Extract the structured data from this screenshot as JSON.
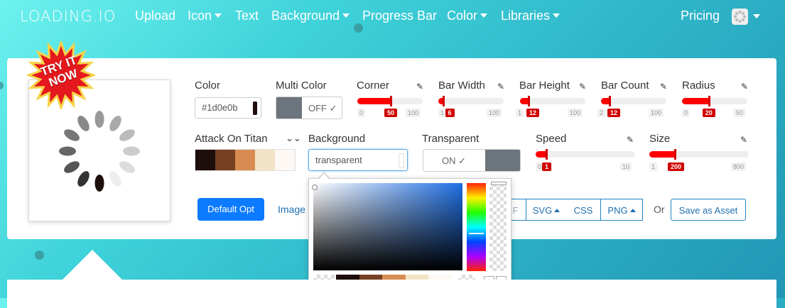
{
  "nav": {
    "brand": "LOADING.IO",
    "items": [
      {
        "label": "Upload",
        "dropdown": false
      },
      {
        "label": "Icon",
        "dropdown": true
      },
      {
        "label": "Text",
        "dropdown": false
      },
      {
        "label": "Background",
        "dropdown": true
      },
      {
        "label": "Progress Bar",
        "dropdown": false
      },
      {
        "label": "Color",
        "dropdown": true
      },
      {
        "label": "Libraries",
        "dropdown": true
      }
    ],
    "pricing": "Pricing"
  },
  "badge": {
    "text": "TRY IT NOW"
  },
  "controls": {
    "color": {
      "label": "Color",
      "value": "#1d0e0b"
    },
    "multi_color": {
      "label": "Multi Color",
      "state": "OFF"
    },
    "corner": {
      "label": "Corner",
      "min": "0",
      "max": "100",
      "value": "50",
      "fraction": 0.5
    },
    "bar_width": {
      "label": "Bar Width",
      "min": "1",
      "max": "100",
      "value": "6",
      "fraction": 0.06
    },
    "bar_height": {
      "label": "Bar Height",
      "min": "1",
      "max": "100",
      "value": "12",
      "fraction": 0.12
    },
    "bar_count": {
      "label": "Bar Count",
      "min": "2",
      "max": "100",
      "value": "12",
      "fraction": 0.12
    },
    "radius": {
      "label": "Radius",
      "min": "0",
      "max": "50",
      "value": "20",
      "fraction": 0.4
    },
    "palette": {
      "label": "Attack On Titan",
      "colors": [
        "#1d0e0b",
        "#774023",
        "#d88c51",
        "#f3e3c6",
        "#fdf8f3"
      ]
    },
    "background": {
      "label": "Background",
      "value": "transparent"
    },
    "transparent": {
      "label": "Transparent",
      "state": "ON"
    },
    "speed": {
      "label": "Speed",
      "min": "0.01",
      "max": "10",
      "value": "1",
      "fraction": 0.1
    },
    "size": {
      "label": "Size",
      "min": "1",
      "max": "800",
      "value": "200",
      "fraction": 0.25
    }
  },
  "actions": {
    "default_opt": "Default Opt",
    "image": "Image",
    "gif_partial": "F",
    "svg": "SVG",
    "css": "CSS",
    "png": "PNG",
    "or": "Or",
    "save_asset": "Save as Asset"
  },
  "picker": {
    "palette": [
      "#1d0e0b",
      "#774023",
      "#d88c51",
      "#f3e3c6",
      "#fdf8f3"
    ],
    "plus": "+",
    "minus": "−"
  },
  "spinner": {
    "colors": [
      "#1d0e0b",
      "#333",
      "#555",
      "#666",
      "#777",
      "#888",
      "#999",
      "#aaa",
      "#bbb",
      "#ccc",
      "#ddd",
      "#eee"
    ]
  }
}
